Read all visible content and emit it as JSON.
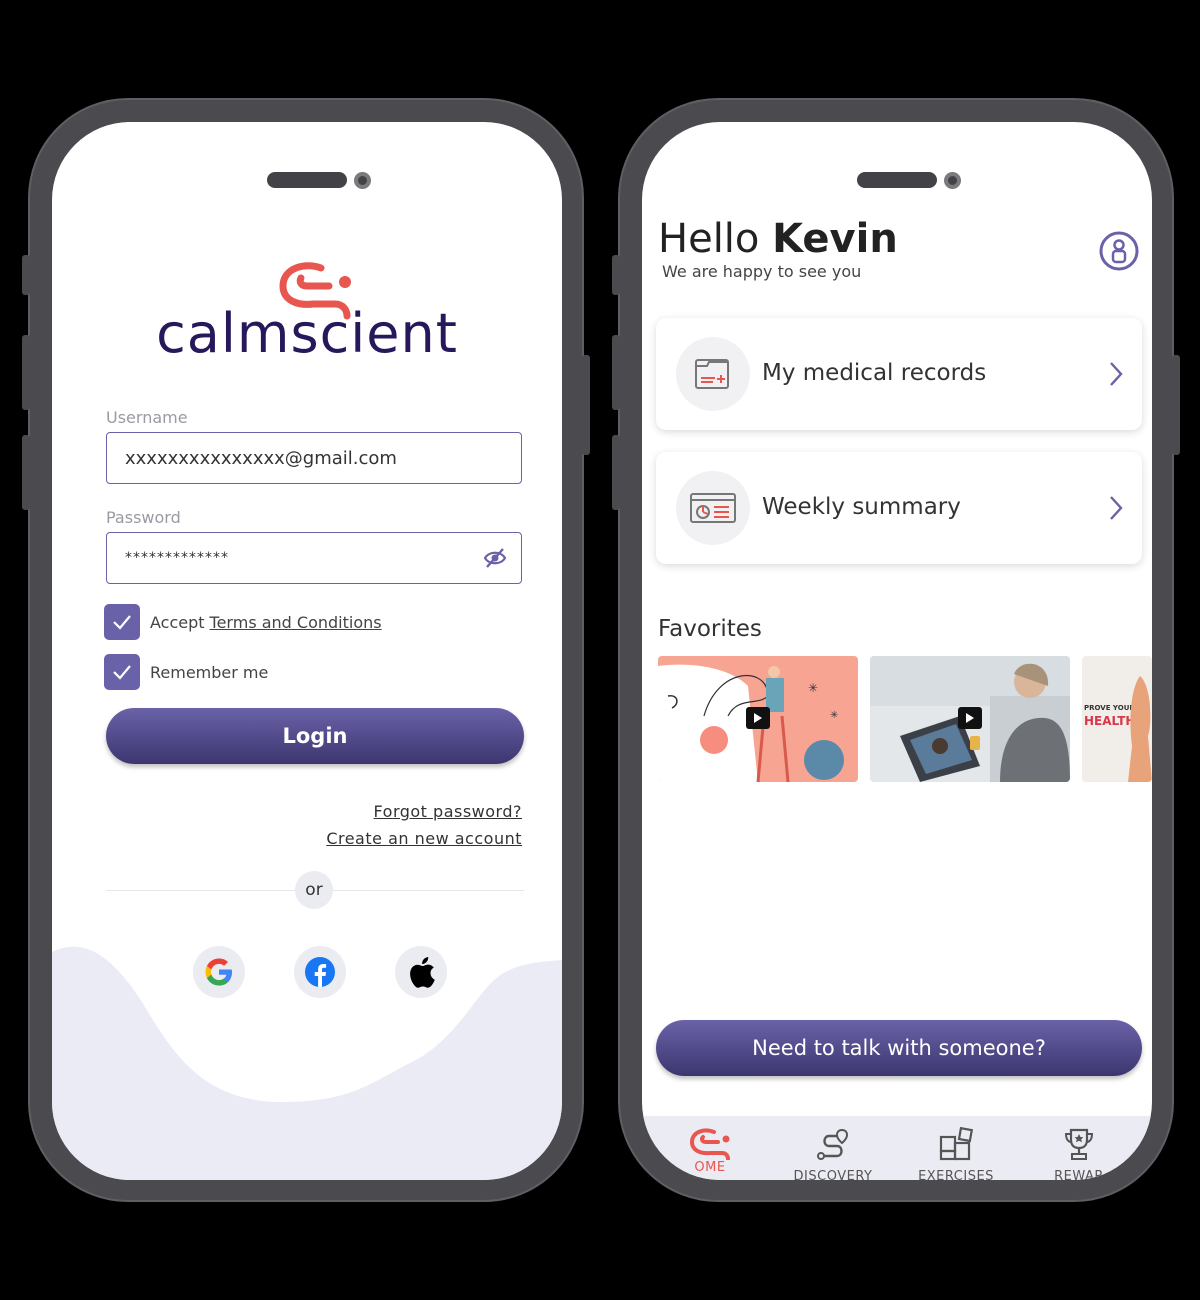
{
  "login": {
    "logo_text": "calmscient",
    "username_label": "Username",
    "username_value": "xxxxxxxxxxxxxxx@gmail.com",
    "password_label": "Password",
    "password_value": "*************",
    "accept_prefix": "Accept",
    "terms_link": "Terms and Conditions",
    "remember_label": "Remember me",
    "login_button": "Login",
    "forgot_link": "Forgot password?",
    "create_link": "Create an new account",
    "or_label": "or",
    "social": [
      "google-icon",
      "facebook-icon",
      "apple-icon"
    ]
  },
  "home": {
    "greeting": "Hello",
    "name": "Kevin",
    "subtitle": "We are happy to see you",
    "cards": [
      {
        "label": "My medical records",
        "icon": "medical-records-icon"
      },
      {
        "label": "Weekly summary",
        "icon": "weekly-summary-icon"
      }
    ],
    "favorites_title": "Favorites",
    "favorite_3_text": "PROVE YOUR",
    "favorite_3_big": "HEALTH",
    "talk_button": "Need to talk with someone?",
    "tabs": [
      {
        "label": "OME",
        "icon": "home-logo-icon"
      },
      {
        "label": "DISCOVERY",
        "icon": "discovery-icon"
      },
      {
        "label": "EXERCISES",
        "icon": "exercises-icon"
      },
      {
        "label": "REWAR",
        "icon": "rewards-icon"
      }
    ]
  },
  "colors": {
    "accent": "#6a62a8",
    "brand_dark": "#26185a",
    "brand_red": "#e8574f",
    "bg_light": "#ebebf3"
  }
}
